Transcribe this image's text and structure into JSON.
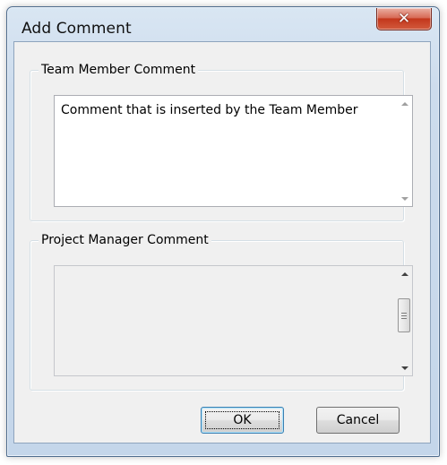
{
  "window": {
    "title": "Add Comment",
    "close_symbol": "✕",
    "close_icon": "close-icon"
  },
  "team_member_group": {
    "label": "Team Member Comment",
    "text": "Comment that is inserted by the Team Member"
  },
  "project_manager_group": {
    "label": "Project Manager Comment",
    "text": ""
  },
  "buttons": {
    "ok_label": "OK",
    "cancel_label": "Cancel"
  },
  "colors": {
    "frame_top": "#d9e6f3",
    "frame_bottom": "#c4d6ea",
    "client_bg": "#f0f0f0",
    "close_red": "#c3371c",
    "ok_focus_border": "#3c7fb1"
  }
}
